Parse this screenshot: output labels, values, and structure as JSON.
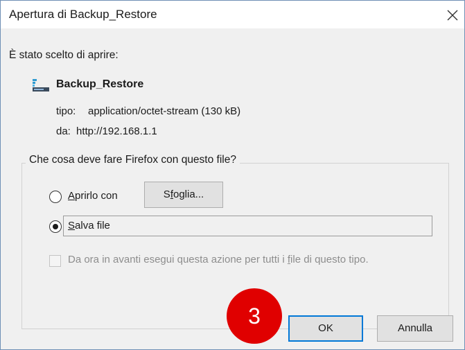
{
  "dialog": {
    "title": "Apertura di Backup_Restore",
    "intro": "È stato scelto di aprire:",
    "file_name": "Backup_Restore",
    "type_label": "tipo:",
    "type_value": "application/octet-stream (130 kB)",
    "from_label": "da:",
    "from_value": "http://192.168.1.1",
    "question": "Che cosa deve fare Firefox con questo file?",
    "open_with_mnemonic": "A",
    "open_with_rest": "prirlo con",
    "browse_pre": "S",
    "browse_mnemonic": "f",
    "browse_rest": "oglia...",
    "save_mnemonic": "S",
    "save_rest": "alva file",
    "save_selected": true,
    "remember_pre": "Da ora in avanti esegui questa azione per tutti i ",
    "remember_mnemonic": "f",
    "remember_rest": "ile di questo tipo.",
    "ok_label": "OK",
    "cancel_label": "Annulla",
    "step_badge": "3"
  },
  "icons": [
    "close-icon",
    "file-icon",
    "radio-icon",
    "checkbox-icon"
  ],
  "colors": {
    "dialog_bg": "#f0f0f0",
    "button_bg": "#e1e1e1",
    "ok_border": "#0078d7",
    "badge": "#e00000",
    "window_border": "#6e8fb5"
  }
}
